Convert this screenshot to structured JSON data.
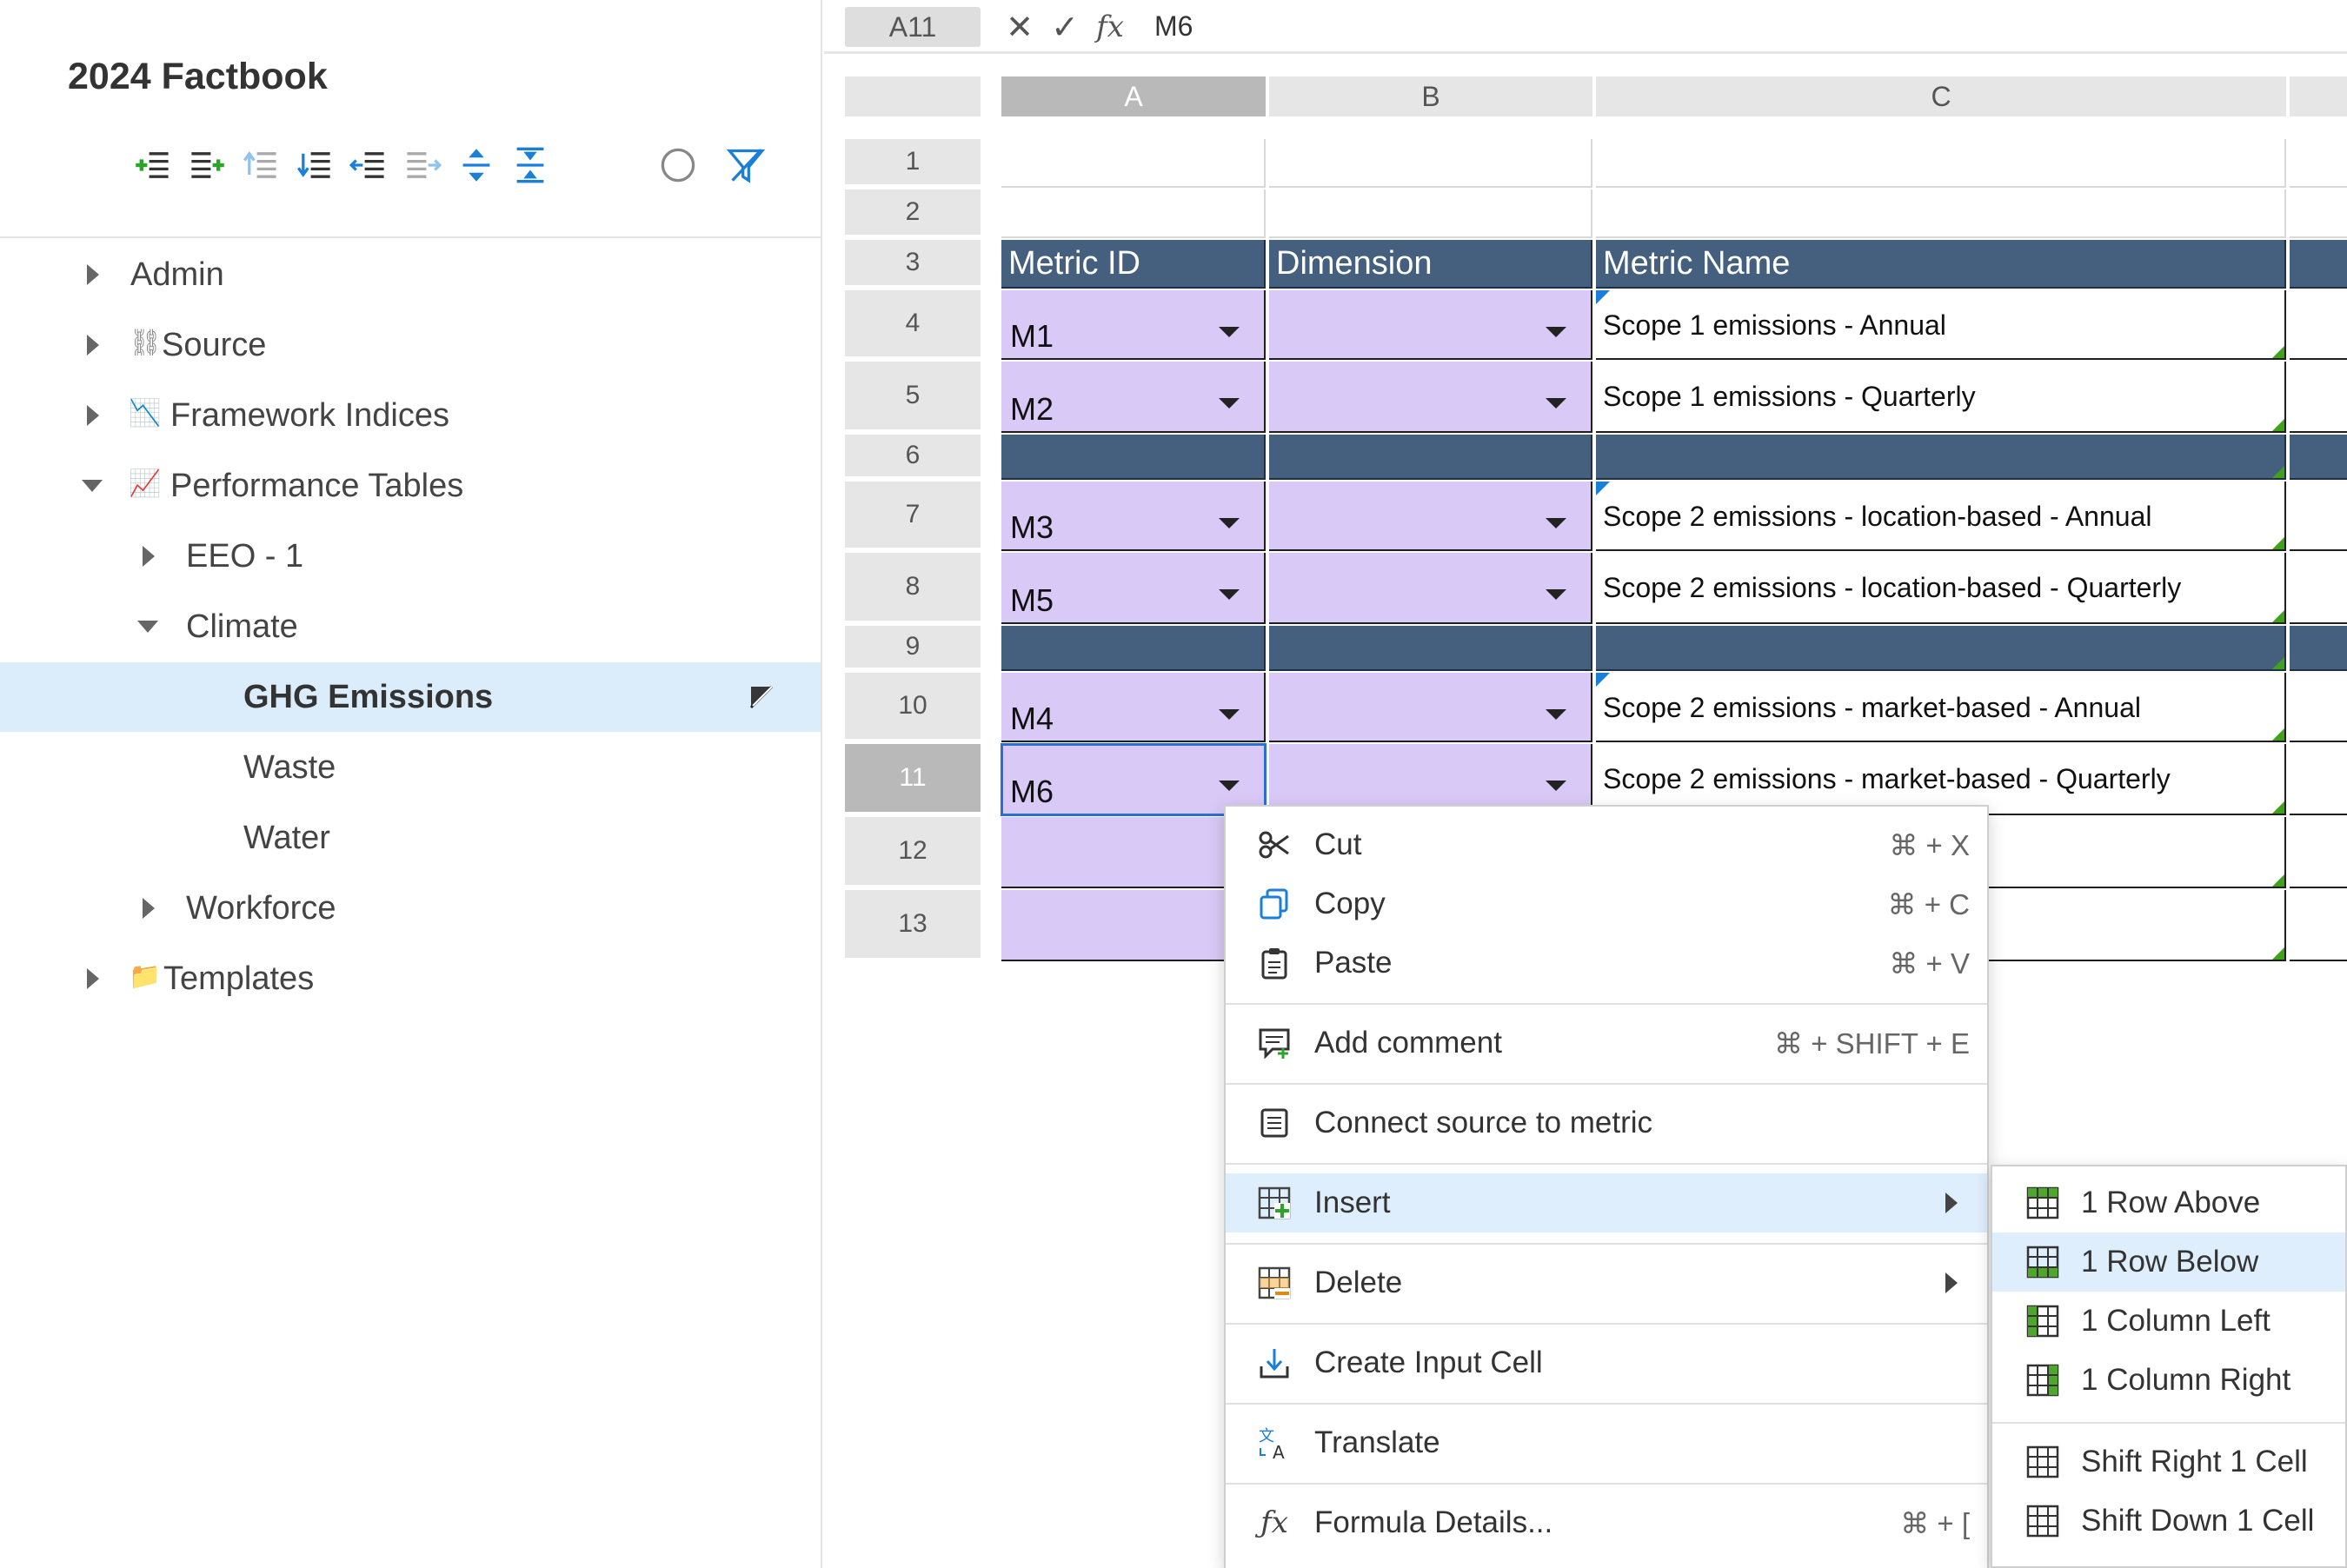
{
  "sidebar": {
    "title": "2024 Factbook",
    "toolbar_icons": [
      "indent-add-icon",
      "indent-add-child-icon",
      "move-up-icon",
      "move-down-icon",
      "outdent-icon",
      "indent-icon",
      "expand-all-icon",
      "collapse-all-icon",
      "circle-icon",
      "filter-icon"
    ],
    "tree": [
      {
        "label": "Admin",
        "icon": "",
        "caret": "right"
      },
      {
        "label": "Source",
        "icon": "⛓",
        "caret": "right"
      },
      {
        "label": "Framework Indices",
        "icon": "📉",
        "caret": "right"
      },
      {
        "label": "Performance Tables",
        "icon": "📈",
        "caret": "down"
      },
      {
        "label": "EEO - 1",
        "caret": "right"
      },
      {
        "label": "Climate",
        "caret": "down"
      },
      {
        "label": "GHG Emissions",
        "selected": true
      },
      {
        "label": "Waste"
      },
      {
        "label": "Water"
      },
      {
        "label": "Workforce",
        "caret": "right"
      },
      {
        "label": "Templates",
        "icon": "📁",
        "caret": "right"
      }
    ]
  },
  "formula_bar": {
    "cell_ref": "A11",
    "cancel_icon": "✕",
    "confirm_icon": "✓",
    "fx_label": "fx",
    "value": "M6"
  },
  "grid": {
    "columns": [
      "A",
      "B",
      "C"
    ],
    "rows": [
      "1",
      "2",
      "3",
      "4",
      "5",
      "6",
      "7",
      "8",
      "9",
      "10",
      "11",
      "12",
      "13"
    ],
    "active_row": "11",
    "active_col": "A",
    "headers": {
      "a": "Metric ID",
      "b": "Dimension",
      "c": "Metric Name"
    },
    "data": [
      {
        "row": "4",
        "id": "M1",
        "name": "Scope 1 emissions - Annual"
      },
      {
        "row": "5",
        "id": "M2",
        "name": "Scope 1 emissions - Quarterly"
      },
      {
        "row": "7",
        "id": "M3",
        "name": "Scope 2 emissions - location-based - Annual"
      },
      {
        "row": "8",
        "id": "M5",
        "name": "Scope 2 emissions - location-based - Quarterly"
      },
      {
        "row": "10",
        "id": "M4",
        "name": "Scope 2 emissions - market-based - Annual"
      },
      {
        "row": "11",
        "id": "M6",
        "name": "Scope 2 emissions - market-based - Quarterly"
      }
    ]
  },
  "context_menu": {
    "items": [
      {
        "label": "Cut",
        "shortcut": "⌘ + X",
        "icon": "scissors-icon"
      },
      {
        "label": "Copy",
        "shortcut": "⌘ + C",
        "icon": "copy-icon"
      },
      {
        "label": "Paste",
        "shortcut": "⌘ + V",
        "icon": "clipboard-icon"
      },
      {
        "label": "Add comment",
        "shortcut": "⌘ + SHIFT + E",
        "icon": "comment-icon"
      },
      {
        "label": "Connect source to metric",
        "shortcut": "",
        "icon": "connect-icon"
      },
      {
        "label": "Insert",
        "shortcut": "",
        "icon": "insert-icon"
      },
      {
        "label": "Delete",
        "shortcut": "",
        "icon": "delete-grid-icon"
      },
      {
        "label": "Create Input Cell",
        "shortcut": "",
        "icon": "input-cell-icon"
      },
      {
        "label": "Translate",
        "shortcut": "",
        "icon": "translate-icon"
      },
      {
        "label": "Formula Details...",
        "shortcut": "⌘ + [",
        "icon": "fx-icon"
      }
    ]
  },
  "submenu": {
    "items": [
      {
        "label": "1 Row Above"
      },
      {
        "label": "1 Row Below"
      },
      {
        "label": "1 Column Left"
      },
      {
        "label": "1 Column Right"
      },
      {
        "label": "Shift Right 1 Cell"
      },
      {
        "label": "Shift Down 1 Cell"
      }
    ]
  },
  "colors": {
    "header_fill": "#455f7f",
    "picker_fill": "#d8c9f6",
    "selected_tree": "#dbedfb",
    "hover_menu": "#deeefc",
    "accent_blue": "#1a7fd9",
    "accent_green": "#3fa21a"
  }
}
